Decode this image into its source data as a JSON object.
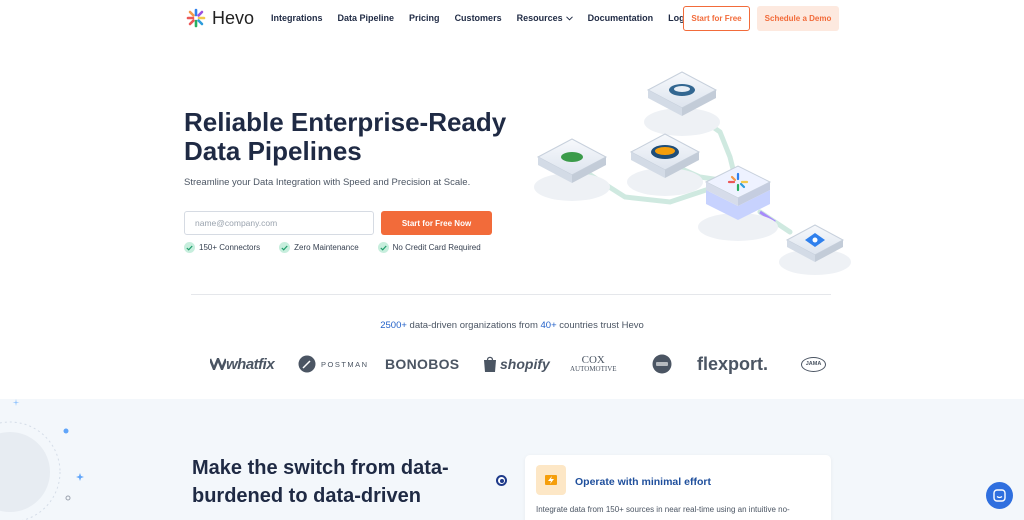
{
  "nav": {
    "brand": "Hevo",
    "links": [
      "Integrations",
      "Data Pipeline",
      "Pricing",
      "Customers",
      "Resources",
      "Documentation",
      "Login"
    ],
    "start_free": "Start for Free",
    "schedule_demo": "Schedule a Demo"
  },
  "hero": {
    "title": "Reliable Enterprise-Ready Data Pipelines",
    "subtitle": "Streamline your Data Integration with Speed and Precision at Scale.",
    "email_placeholder": "name@company.com",
    "email_value": "",
    "cta": "Start for Free Now",
    "checks": [
      "150+ Connectors",
      "Zero Maintenance",
      "No Credit Card Required"
    ]
  },
  "trust": {
    "count": "2500+",
    "text_mid": " data-driven organizations from ",
    "countries": "40+",
    "text_end": " countries trust Hevo"
  },
  "logos": {
    "whatfix": "whatfix",
    "postman": "POSTMAN",
    "bonobos": "BONOBOS",
    "shopify": "shopify",
    "cox_line1": "COX",
    "cox_line2": "AUTOMOTIVE",
    "flexport": "flexport.",
    "jama": "JAMA"
  },
  "section2": {
    "title": "Make the switch from data-burdened to data-driven",
    "feature_title": "Operate with minimal effort",
    "feature_desc": "Integrate data from 150+ sources in near real-time using an intuitive no-"
  },
  "colors": {
    "accent": "#f26b3a",
    "navy": "#1f2a44",
    "link_blue": "#2563c9",
    "check_green": "#c7eedd"
  },
  "icons": [
    "hevo-logo-icon",
    "chevron-down-icon",
    "check-icon",
    "chat-icon",
    "bolt-icon"
  ]
}
